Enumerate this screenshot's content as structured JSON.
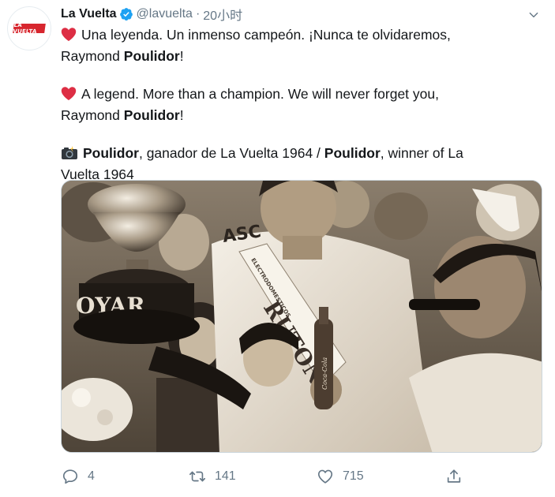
{
  "tweet": {
    "author_name": "La Vuelta",
    "handle": "@lavuelta",
    "separator": "·",
    "time": "20小时",
    "avatar_text": "LA VUELTA",
    "lines": {
      "es_1": "Una leyenda. Un inmenso campeón. ¡Nunca te olvidaremos,",
      "es_2_pre": "Raymond ",
      "es_2_bold": "Poulidor",
      "es_2_post": "!",
      "en_1": "A legend. More than a champion. We will never forget you,",
      "en_2_pre": "Raymond ",
      "en_2_bold": "Poulidor",
      "en_2_post": "!",
      "cap_bold_1": "Poulidor",
      "cap_mid": ", ganador de La Vuelta 1964 / ",
      "cap_bold_2": "Poulidor",
      "cap_end_1": ", winner of La",
      "cap_end_2": "Vuelta 1964"
    },
    "photo_texts": {
      "sash_small": "ELECTRODOMESTICOS",
      "sash_brand": "RUTON",
      "jersey": "ASC",
      "trophy_base": "OYAR",
      "bottle": "Coca-Cola"
    },
    "actions": {
      "replies": "4",
      "retweets": "141",
      "likes": "715"
    },
    "icons": {
      "verified": "verified-badge-icon",
      "caret": "chevron-down-icon",
      "reply": "reply-icon",
      "retweet": "retweet-icon",
      "like": "heart-icon",
      "share": "share-icon",
      "heart_emoji": "red-heart-emoji",
      "camera_emoji": "camera-flash-emoji"
    },
    "colors": {
      "text": "#14171a",
      "secondary": "#657786",
      "verified": "#1da1f2",
      "heart": "#e0245e",
      "brand_red": "#d7262e"
    }
  }
}
